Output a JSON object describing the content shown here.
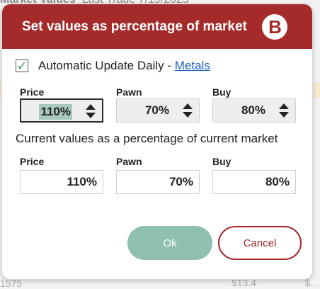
{
  "background": {
    "title_bold": "Market Values",
    "title_rest": "Last Trade 7/19/2023",
    "footer_left": "1575",
    "footer_amount_1": "$13.4",
    "footer_amount_2": "$..."
  },
  "dialog": {
    "title": "Set values as percentage of market",
    "logo_letter": "B",
    "auto_update": {
      "checked": true,
      "label": "Automatic Update Daily - ",
      "link": "Metals"
    },
    "editable": {
      "price_label": "Price",
      "pawn_label": "Pawn",
      "buy_label": "Buy",
      "price_value": "110%",
      "pawn_value": "70%",
      "buy_value": "80%"
    },
    "current_title": "Current values as a percentage of current market",
    "current": {
      "price_label": "Price",
      "pawn_label": "Pawn",
      "buy_label": "Buy",
      "price_value": "110%",
      "pawn_value": "70%",
      "buy_value": "80%"
    },
    "ok_label": "Ok",
    "cancel_label": "Cancel"
  },
  "colors": {
    "header": "#a52a2a",
    "ok_button": "#8ebfb0",
    "link": "#1a5fc4",
    "check": "#3aa46b"
  }
}
